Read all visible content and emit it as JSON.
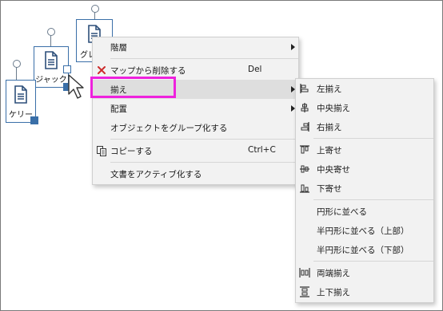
{
  "nodes": [
    {
      "label": "グレ"
    },
    {
      "label": "ジャック"
    },
    {
      "label": "ケリー"
    }
  ],
  "context_menu": [
    {
      "label": "階層",
      "shortcut": "",
      "submenu": true,
      "icon": ""
    },
    {
      "label": "マップから削除する",
      "shortcut": "Del",
      "submenu": false,
      "icon": "delete-x-icon"
    },
    {
      "label": "揃え",
      "shortcut": "",
      "submenu": true,
      "icon": "",
      "highlighted": true
    },
    {
      "label": "配置",
      "shortcut": "",
      "submenu": true,
      "icon": ""
    },
    {
      "label": "オブジェクトをグループ化する",
      "shortcut": "",
      "submenu": false,
      "icon": ""
    },
    {
      "label": "コピーする",
      "shortcut": "Ctrl+C",
      "submenu": false,
      "icon": "copy-icon"
    },
    {
      "label": "文書をアクティブ化する",
      "shortcut": "",
      "submenu": false,
      "icon": ""
    }
  ],
  "align_submenu": [
    {
      "label": "左揃え",
      "icon": "align-left-icon"
    },
    {
      "label": "中央揃え",
      "icon": "align-center-icon"
    },
    {
      "label": "右揃え",
      "icon": "align-right-icon"
    },
    {
      "label": "上寄せ",
      "icon": "align-top-icon"
    },
    {
      "label": "中央寄せ",
      "icon": "align-middle-icon"
    },
    {
      "label": "下寄せ",
      "icon": "align-bottom-icon"
    },
    {
      "label": "円形に並べる",
      "icon": ""
    },
    {
      "label": "半円形に並べる（上部）",
      "icon": ""
    },
    {
      "label": "半円形に並べる（下部）",
      "icon": ""
    },
    {
      "label": "両端揃え",
      "icon": "distribute-horizontal-icon"
    },
    {
      "label": "上下揃え",
      "icon": "distribute-vertical-icon"
    }
  ],
  "colors": {
    "accent": "#3a6fa8",
    "highlight_box": "#ee22dd",
    "delete_icon": "#cc2a2a"
  }
}
